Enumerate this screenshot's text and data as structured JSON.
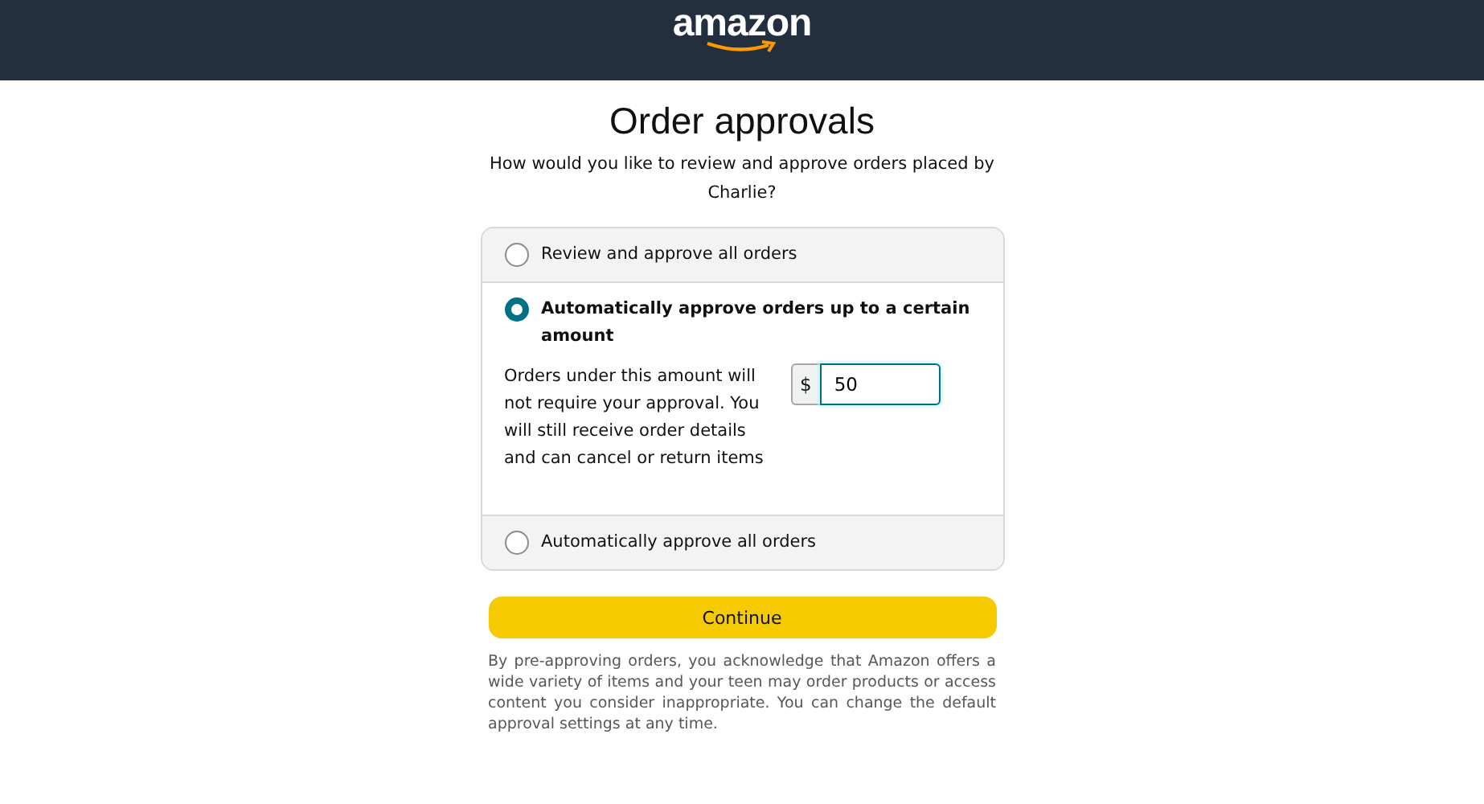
{
  "header": {
    "logo": "amazon"
  },
  "title": "Order approvals",
  "subtitle": "How would you like to review and approve orders placed by Charlie?",
  "options": [
    {
      "label": "Review and approve all orders",
      "selected": false
    },
    {
      "label": "Automatically approve orders up to a certain amount",
      "selected": true,
      "detail": "Orders under this amount will not require your approval. You will still receive order details and can cancel or return items",
      "currency": "$",
      "amount": "50"
    },
    {
      "label": "Automatically approve all orders",
      "selected": false
    }
  ],
  "button": "Continue",
  "disclaimer": "By pre-approving orders, you acknowledge that Amazon offers a wide variety of items and your teen may order products or access content you consider inappropriate. You can change the default approval settings at any time."
}
